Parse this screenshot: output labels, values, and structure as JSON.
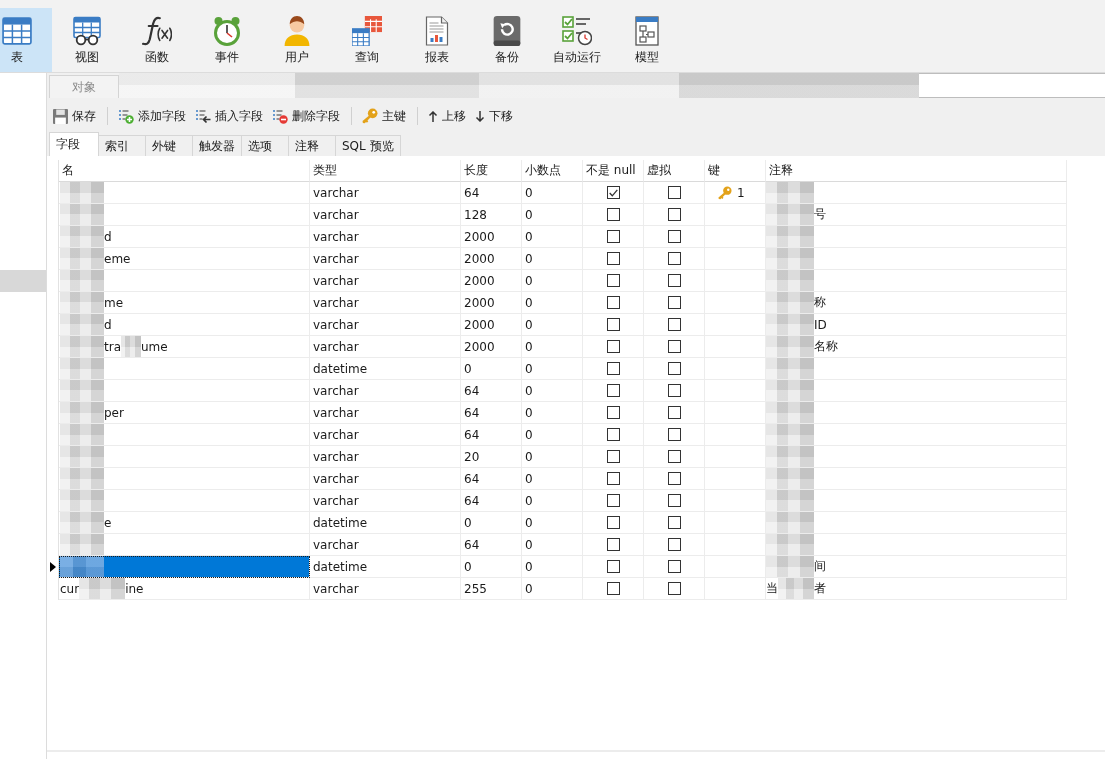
{
  "ribbon": [
    {
      "label": "表",
      "selected": true
    },
    {
      "label": "视图",
      "selected": false
    },
    {
      "label": "函数",
      "selected": false
    },
    {
      "label": "事件",
      "selected": false
    },
    {
      "label": "用户",
      "selected": false
    },
    {
      "label": "查询",
      "selected": false
    },
    {
      "label": "报表",
      "selected": false
    },
    {
      "label": "备份",
      "selected": false
    },
    {
      "label": "自动运行",
      "selected": false
    },
    {
      "label": "模型",
      "selected": false
    }
  ],
  "object_bar": {
    "label": "对象"
  },
  "toolbar": {
    "groups": [
      [
        "保存"
      ],
      [
        "添加字段",
        "插入字段",
        "删除字段"
      ],
      [
        "主键"
      ],
      [
        "上移",
        "下移"
      ]
    ]
  },
  "tabs": [
    {
      "label": "字段",
      "selected": true
    },
    {
      "label": "索引",
      "selected": false
    },
    {
      "label": "外键",
      "selected": false
    },
    {
      "label": "触发器",
      "selected": false
    },
    {
      "label": "选项",
      "selected": false
    },
    {
      "label": "注释",
      "selected": false
    },
    {
      "label": "SQL 预览",
      "selected": false
    }
  ],
  "table": {
    "columns": [
      "名",
      "类型",
      "长度",
      "小数点",
      "不是 null",
      "虚拟",
      "键",
      "注释"
    ],
    "rows": [
      {
        "name": [
          {
            "kind": "redacted"
          }
        ],
        "type": "varchar",
        "length": "64",
        "decimals": "0",
        "not_null": true,
        "virtual": false,
        "key": "1",
        "comment": [
          {
            "kind": "redacted"
          }
        ],
        "selected": false
      },
      {
        "name": [
          {
            "kind": "redacted"
          }
        ],
        "type": "varchar",
        "length": "128",
        "decimals": "0",
        "not_null": false,
        "virtual": false,
        "comment": [
          {
            "kind": "redacted"
          },
          {
            "kind": "text",
            "text": "号"
          }
        ],
        "selected": false
      },
      {
        "name": [
          {
            "kind": "redacted"
          },
          {
            "kind": "text",
            "text": "d"
          }
        ],
        "type": "varchar",
        "length": "2000",
        "decimals": "0",
        "not_null": false,
        "virtual": false,
        "comment": [
          {
            "kind": "redacted"
          }
        ],
        "selected": false
      },
      {
        "name": [
          {
            "kind": "redacted"
          },
          {
            "kind": "text",
            "text": "eme"
          }
        ],
        "type": "varchar",
        "length": "2000",
        "decimals": "0",
        "not_null": false,
        "virtual": false,
        "comment": [
          {
            "kind": "redacted"
          }
        ],
        "selected": false
      },
      {
        "name": [
          {
            "kind": "redacted"
          }
        ],
        "type": "varchar",
        "length": "2000",
        "decimals": "0",
        "not_null": false,
        "virtual": false,
        "comment": [
          {
            "kind": "redacted"
          }
        ],
        "selected": false
      },
      {
        "name": [
          {
            "kind": "redacted"
          },
          {
            "kind": "text",
            "text": "me"
          }
        ],
        "type": "varchar",
        "length": "2000",
        "decimals": "0",
        "not_null": false,
        "virtual": false,
        "comment": [
          {
            "kind": "redacted"
          },
          {
            "kind": "text",
            "text": "称"
          }
        ],
        "selected": false
      },
      {
        "name": [
          {
            "kind": "redacted"
          },
          {
            "kind": "text",
            "text": "d"
          }
        ],
        "type": "varchar",
        "length": "2000",
        "decimals": "0",
        "not_null": false,
        "virtual": false,
        "comment": [
          {
            "kind": "redacted"
          },
          {
            "kind": "text",
            "text": "ID"
          }
        ],
        "selected": false
      },
      {
        "name": [
          {
            "kind": "redacted"
          },
          {
            "kind": "text",
            "text": "tra"
          },
          {
            "kind": "redacted"
          },
          {
            "kind": "text",
            "text": "ume"
          }
        ],
        "type": "varchar",
        "length": "2000",
        "decimals": "0",
        "not_null": false,
        "virtual": false,
        "comment": [
          {
            "kind": "redacted"
          },
          {
            "kind": "text",
            "text": "名称"
          }
        ],
        "selected": false
      },
      {
        "name": [
          {
            "kind": "redacted"
          }
        ],
        "type": "datetime",
        "length": "0",
        "decimals": "0",
        "not_null": false,
        "virtual": false,
        "comment": [
          {
            "kind": "redacted"
          }
        ],
        "selected": false
      },
      {
        "name": [
          {
            "kind": "redacted"
          }
        ],
        "type": "varchar",
        "length": "64",
        "decimals": "0",
        "not_null": false,
        "virtual": false,
        "comment": [
          {
            "kind": "redacted"
          }
        ],
        "selected": false
      },
      {
        "name": [
          {
            "kind": "redacted"
          },
          {
            "kind": "text",
            "text": "per"
          }
        ],
        "type": "varchar",
        "length": "64",
        "decimals": "0",
        "not_null": false,
        "virtual": false,
        "comment": [
          {
            "kind": "redacted"
          }
        ],
        "selected": false
      },
      {
        "name": [
          {
            "kind": "redacted"
          }
        ],
        "type": "varchar",
        "length": "64",
        "decimals": "0",
        "not_null": false,
        "virtual": false,
        "comment": [
          {
            "kind": "redacted"
          }
        ],
        "selected": false
      },
      {
        "name": [
          {
            "kind": "redacted"
          }
        ],
        "type": "varchar",
        "length": "20",
        "decimals": "0",
        "not_null": false,
        "virtual": false,
        "comment": [
          {
            "kind": "redacted"
          }
        ],
        "selected": false
      },
      {
        "name": [
          {
            "kind": "redacted"
          }
        ],
        "type": "varchar",
        "length": "64",
        "decimals": "0",
        "not_null": false,
        "virtual": false,
        "comment": [
          {
            "kind": "redacted"
          }
        ],
        "selected": false
      },
      {
        "name": [
          {
            "kind": "redacted"
          }
        ],
        "type": "varchar",
        "length": "64",
        "decimals": "0",
        "not_null": false,
        "virtual": false,
        "comment": [
          {
            "kind": "redacted"
          }
        ],
        "selected": false
      },
      {
        "name": [
          {
            "kind": "redacted"
          },
          {
            "kind": "text",
            "text": "e"
          }
        ],
        "type": "datetime",
        "length": "0",
        "decimals": "0",
        "not_null": false,
        "virtual": false,
        "comment": [
          {
            "kind": "redacted"
          }
        ],
        "selected": false
      },
      {
        "name": [
          {
            "kind": "redacted"
          }
        ],
        "type": "varchar",
        "length": "64",
        "decimals": "0",
        "not_null": false,
        "virtual": false,
        "comment": [
          {
            "kind": "redacted"
          }
        ],
        "selected": false
      },
      {
        "name": [
          {
            "kind": "redacted"
          }
        ],
        "type": "datetime",
        "length": "0",
        "decimals": "0",
        "not_null": false,
        "virtual": false,
        "comment": [
          {
            "kind": "redacted"
          },
          {
            "kind": "text",
            "text": "间"
          }
        ],
        "selected": true
      },
      {
        "name": [
          {
            "kind": "text",
            "text": "cur"
          },
          {
            "kind": "redacted"
          },
          {
            "kind": "text",
            "text": "ine"
          }
        ],
        "type": "varchar",
        "length": "255",
        "decimals": "0",
        "not_null": false,
        "virtual": false,
        "comment": [
          {
            "kind": "text",
            "text": "当"
          },
          {
            "kind": "redacted"
          },
          {
            "kind": "text",
            "text": "者"
          }
        ],
        "selected": false
      }
    ]
  }
}
